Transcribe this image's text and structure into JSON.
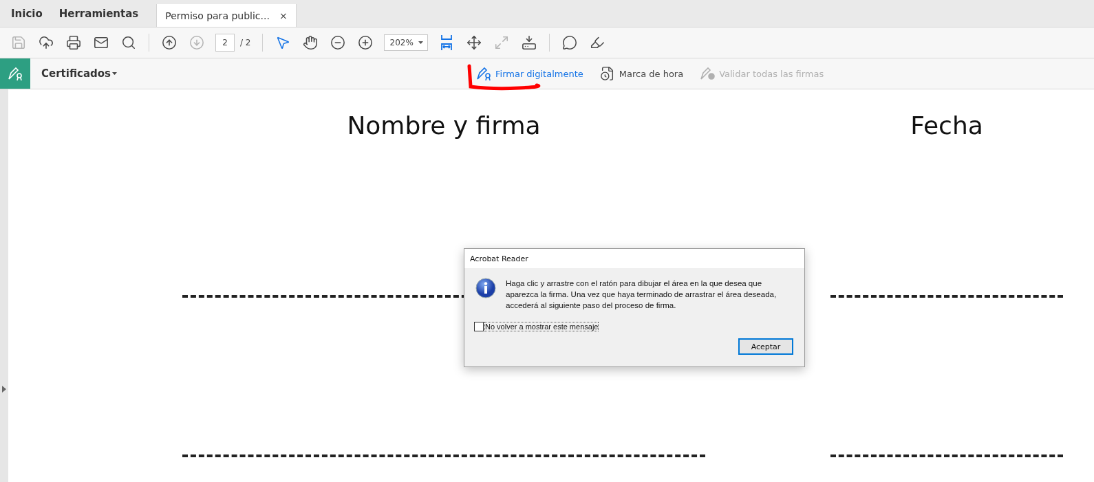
{
  "tabs": [
    {
      "label": "Inicio",
      "kind": "nav",
      "selected": false
    },
    {
      "label": "Herramientas",
      "kind": "nav",
      "selected": false
    },
    {
      "label": "Permiso para public...",
      "kind": "document",
      "selected": true,
      "close": "×"
    }
  ],
  "toolbar": {
    "groups": [
      [
        {
          "kind": "save",
          "disabled": true
        },
        {
          "kind": "upload",
          "disabled": false
        },
        {
          "kind": "print",
          "disabled": false
        },
        {
          "kind": "mail",
          "disabled": false
        },
        {
          "kind": "search",
          "disabled": false
        }
      ],
      [
        {
          "kind": "page-up",
          "disabled": false
        },
        {
          "kind": "page-down",
          "disabled": true
        },
        {
          "kind": "page-field",
          "value": "2",
          "total": "/ 2"
        }
      ],
      [
        {
          "kind": "select",
          "disabled": false,
          "selected": true
        },
        {
          "kind": "hand",
          "disabled": false,
          "selected": false
        },
        {
          "kind": "zoom-out",
          "disabled": false
        },
        {
          "kind": "zoom-in",
          "disabled": false
        },
        {
          "kind": "zoom-field",
          "value": "202%"
        },
        {
          "kind": "fit-width",
          "disabled": false,
          "selected": true
        },
        {
          "kind": "fit-page",
          "disabled": false
        },
        {
          "kind": "full-screen",
          "disabled": true
        },
        {
          "kind": "read-mode",
          "disabled": false
        }
      ],
      [
        {
          "kind": "comment",
          "disabled": false
        },
        {
          "kind": "highlight",
          "disabled": false
        }
      ]
    ]
  },
  "sign_bar": {
    "menu": "Certificados",
    "actions": [
      {
        "kind": "sign",
        "label": "Firmar digitalmente",
        "disabled": false,
        "selected": true
      },
      {
        "kind": "timestamp",
        "label": "Marca de hora",
        "disabled": false,
        "selected": false
      },
      {
        "kind": "validate",
        "label": "Validar todas las firmas",
        "disabled": true,
        "selected": false
      }
    ]
  },
  "document": {
    "headings": [
      "Nombre y firma",
      "Fecha"
    ]
  },
  "dialog": {
    "title": "Acrobat Reader",
    "message": "Haga clic y arrastre con el ratón para dibujar el área en la que desea que aparezca la firma. Una vez que haya terminado de arrastrar el área deseada, accederá al siguiente paso del proceso de firma.",
    "checkbox": {
      "label": "No volver a mostrar este mensaje",
      "checked": false
    },
    "button": "Aceptar"
  }
}
